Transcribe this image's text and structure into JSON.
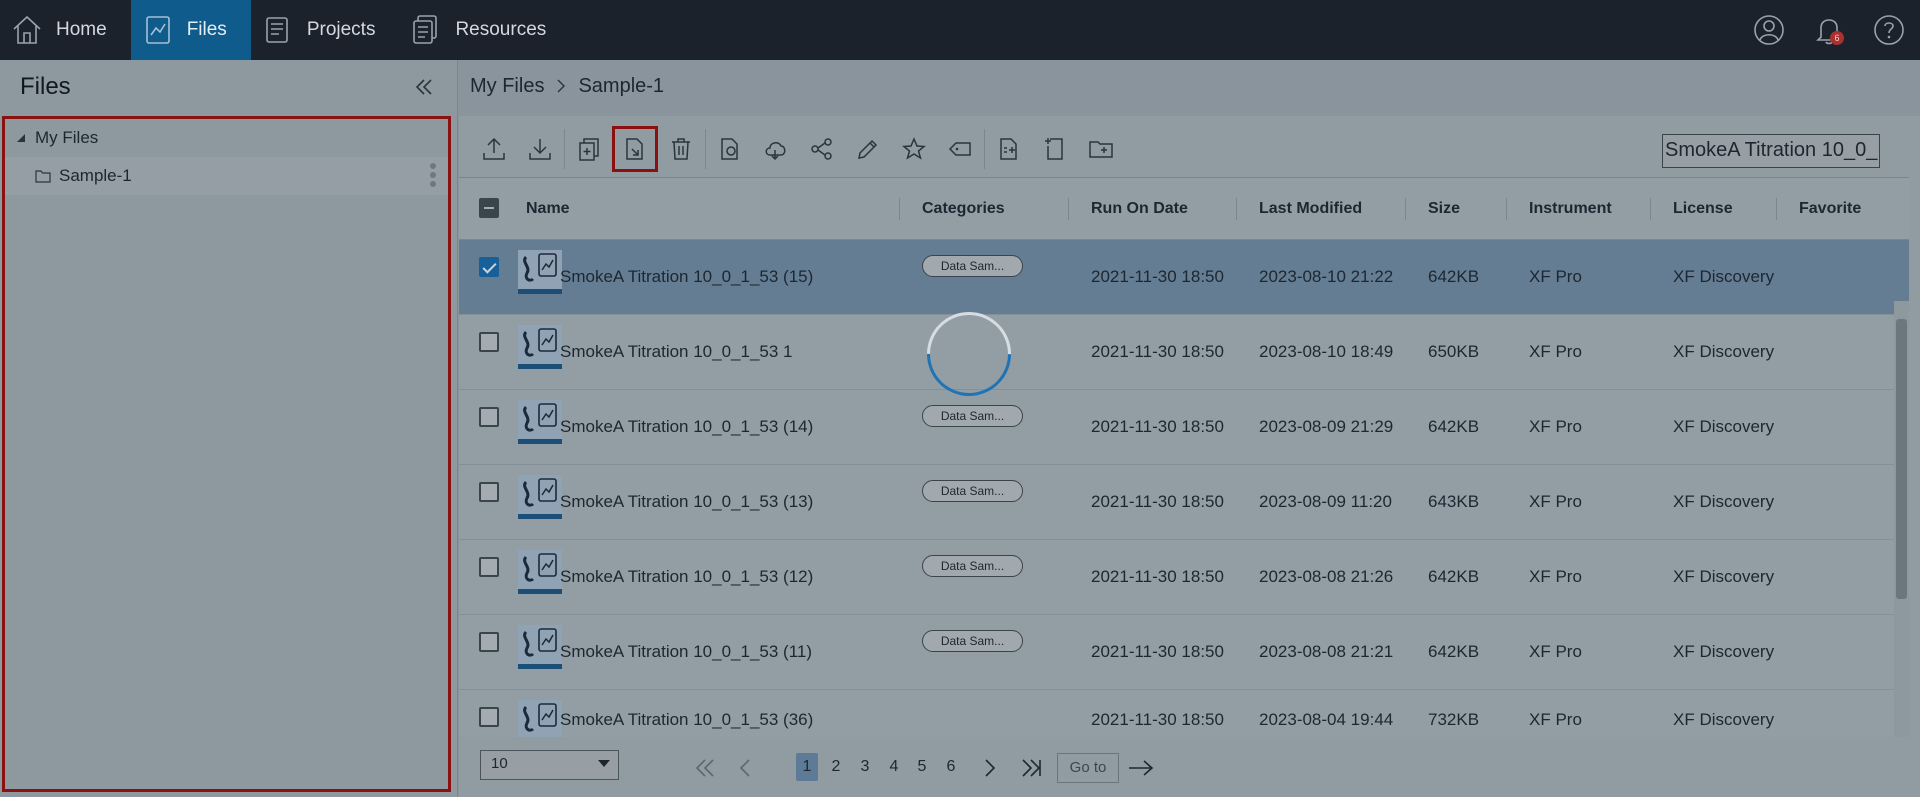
{
  "nav": {
    "items": [
      {
        "label": "Home",
        "icon": "home-icon"
      },
      {
        "label": "Files",
        "icon": "files-chart-icon",
        "active": true
      },
      {
        "label": "Projects",
        "icon": "projects-icon"
      },
      {
        "label": "Resources",
        "icon": "resources-icon"
      }
    ],
    "notification_count": "6"
  },
  "sidebar": {
    "title": "Files",
    "tree": {
      "root_label": "My Files",
      "children": [
        {
          "label": "Sample-1"
        }
      ]
    }
  },
  "breadcrumb": [
    "My Files",
    "Sample-1"
  ],
  "search": {
    "value": "SmokeA Titration 10_0_"
  },
  "table": {
    "columns": [
      "Name",
      "Categories",
      "Run On Date",
      "Last Modified",
      "Size",
      "Instrument",
      "License",
      "Favorite"
    ],
    "rows": [
      {
        "name": "SmokeA Titration 10_0_1_53 (15)",
        "category": "Data Sam...",
        "run_on": "2021-11-30 18:50",
        "modified": "2023-08-10 21:22",
        "size": "642KB",
        "instrument": "XF Pro",
        "license": "XF Discovery",
        "selected": true
      },
      {
        "name": "SmokeA Titration 10_0_1_53 1",
        "category": "",
        "run_on": "2021-11-30 18:50",
        "modified": "2023-08-10 18:49",
        "size": "650KB",
        "instrument": "XF Pro",
        "license": "XF Discovery",
        "selected": false
      },
      {
        "name": "SmokeA Titration 10_0_1_53 (14)",
        "category": "Data Sam...",
        "run_on": "2021-11-30 18:50",
        "modified": "2023-08-09 21:29",
        "size": "642KB",
        "instrument": "XF Pro",
        "license": "XF Discovery",
        "selected": false
      },
      {
        "name": "SmokeA Titration 10_0_1_53 (13)",
        "category": "Data Sam...",
        "run_on": "2021-11-30 18:50",
        "modified": "2023-08-09 11:20",
        "size": "643KB",
        "instrument": "XF Pro",
        "license": "XF Discovery",
        "selected": false
      },
      {
        "name": "SmokeA Titration 10_0_1_53 (12)",
        "category": "Data Sam...",
        "run_on": "2021-11-30 18:50",
        "modified": "2023-08-08 21:26",
        "size": "642KB",
        "instrument": "XF Pro",
        "license": "XF Discovery",
        "selected": false
      },
      {
        "name": "SmokeA Titration 10_0_1_53 (11)",
        "category": "Data Sam...",
        "run_on": "2021-11-30 18:50",
        "modified": "2023-08-08 21:21",
        "size": "642KB",
        "instrument": "XF Pro",
        "license": "XF Discovery",
        "selected": false
      },
      {
        "name": "SmokeA Titration 10_0_1_53 (36)",
        "category": "",
        "run_on": "2021-11-30 18:50",
        "modified": "2023-08-04 19:44",
        "size": "732KB",
        "instrument": "XF Pro",
        "license": "XF Discovery",
        "selected": false
      }
    ]
  },
  "pagination": {
    "page_size": "10",
    "pages": [
      "1",
      "2",
      "3",
      "4",
      "5",
      "6"
    ],
    "current": "1",
    "goto_label": "Go to"
  },
  "colors": {
    "highlight": "#8b1010",
    "accent": "#0e5b8c"
  }
}
